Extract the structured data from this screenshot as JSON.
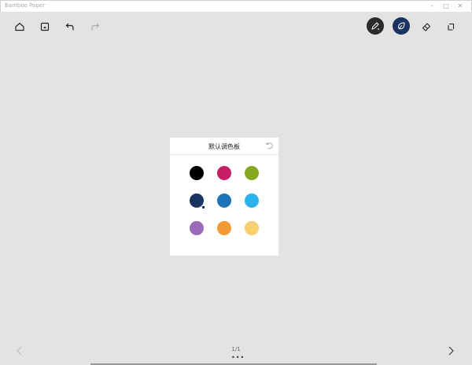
{
  "window": {
    "title": "Bamboo Paper",
    "minimize": "–",
    "maximize": "□",
    "close": "✕"
  },
  "toolbar": {
    "left": [
      "home-icon",
      "image-icon",
      "undo-icon",
      "redo-icon"
    ],
    "right": [
      "pen-icon",
      "ink-drop-icon",
      "eraser-icon",
      "copy-icon"
    ]
  },
  "palette": {
    "title": "默认调色板",
    "colors": [
      "#000000",
      "#c41e66",
      "#86a81f",
      "#1a3461",
      "#1c73b8",
      "#2bb1ec",
      "#9a6bb6",
      "#f39a34",
      "#f9cf6f"
    ],
    "selected_index": 3
  },
  "footer": {
    "page": "1/1",
    "more": "•••"
  },
  "colors": {
    "background": "#e4e3e1",
    "active_tool": "#2b2b2b",
    "active_color_tool": "#1a3461"
  }
}
